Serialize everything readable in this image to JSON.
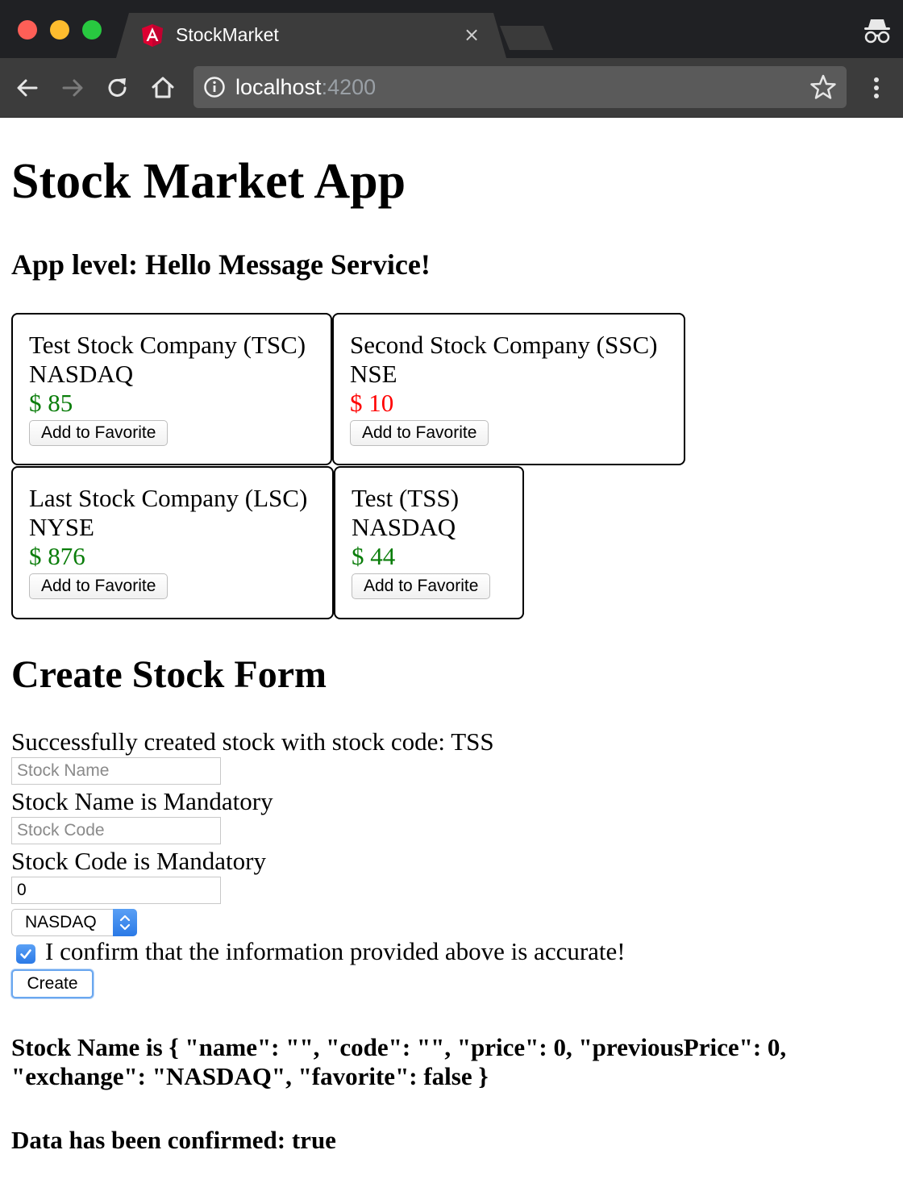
{
  "browser": {
    "tab_title": "StockMarket",
    "tab_close": "×",
    "url_host": "localhost",
    "url_port": ":4200",
    "icons": [
      "angular-favicon",
      "close-icon",
      "incognito-icon",
      "back-arrow-icon",
      "forward-arrow-icon",
      "reload-icon",
      "home-icon",
      "info-icon",
      "star-icon",
      "menu-kebab-icon"
    ]
  },
  "page": {
    "title": "Stock Market App",
    "app_level": "App level: Hello Message Service!"
  },
  "stocks": [
    {
      "name": "Test Stock Company (TSC)",
      "exchange": "NASDAQ",
      "price": "$ 85",
      "trend": "up",
      "button": "Add to Favorite"
    },
    {
      "name": "Second Stock Company (SSC)",
      "exchange": "NSE",
      "price": "$ 10",
      "trend": "down",
      "button": "Add to Favorite"
    },
    {
      "name": "Last Stock Company (LSC)",
      "exchange": "NYSE",
      "price": "$ 876",
      "trend": "up",
      "button": "Add to Favorite"
    },
    {
      "name": "Test (TSS)",
      "exchange": "NASDAQ",
      "price": "$ 44",
      "trend": "up",
      "button": "Add to Favorite"
    }
  ],
  "colors": {
    "price_up": "#0a7d0a",
    "price_down": "#ff0000",
    "accent": "#2a79e6"
  },
  "form": {
    "title": "Create Stock Form",
    "success_message": "Successfully created stock with stock code: TSS",
    "name_placeholder": "Stock Name",
    "name_value": "",
    "name_error": "Stock Name is Mandatory",
    "code_placeholder": "Stock Code",
    "code_value": "",
    "code_error": "Stock Code is Mandatory",
    "price_value": "0",
    "exchange_selected": "NASDAQ",
    "confirm_checked": true,
    "confirm_label": "I confirm that the information provided above is accurate!",
    "create_label": "Create"
  },
  "output": {
    "json_line": "Stock Name is { \"name\": \"\", \"code\": \"\", \"price\": 0, \"previousPrice\": 0, \"exchange\": \"NASDAQ\", \"favorite\": false }",
    "confirmed_line": "Data has been confirmed: true"
  }
}
